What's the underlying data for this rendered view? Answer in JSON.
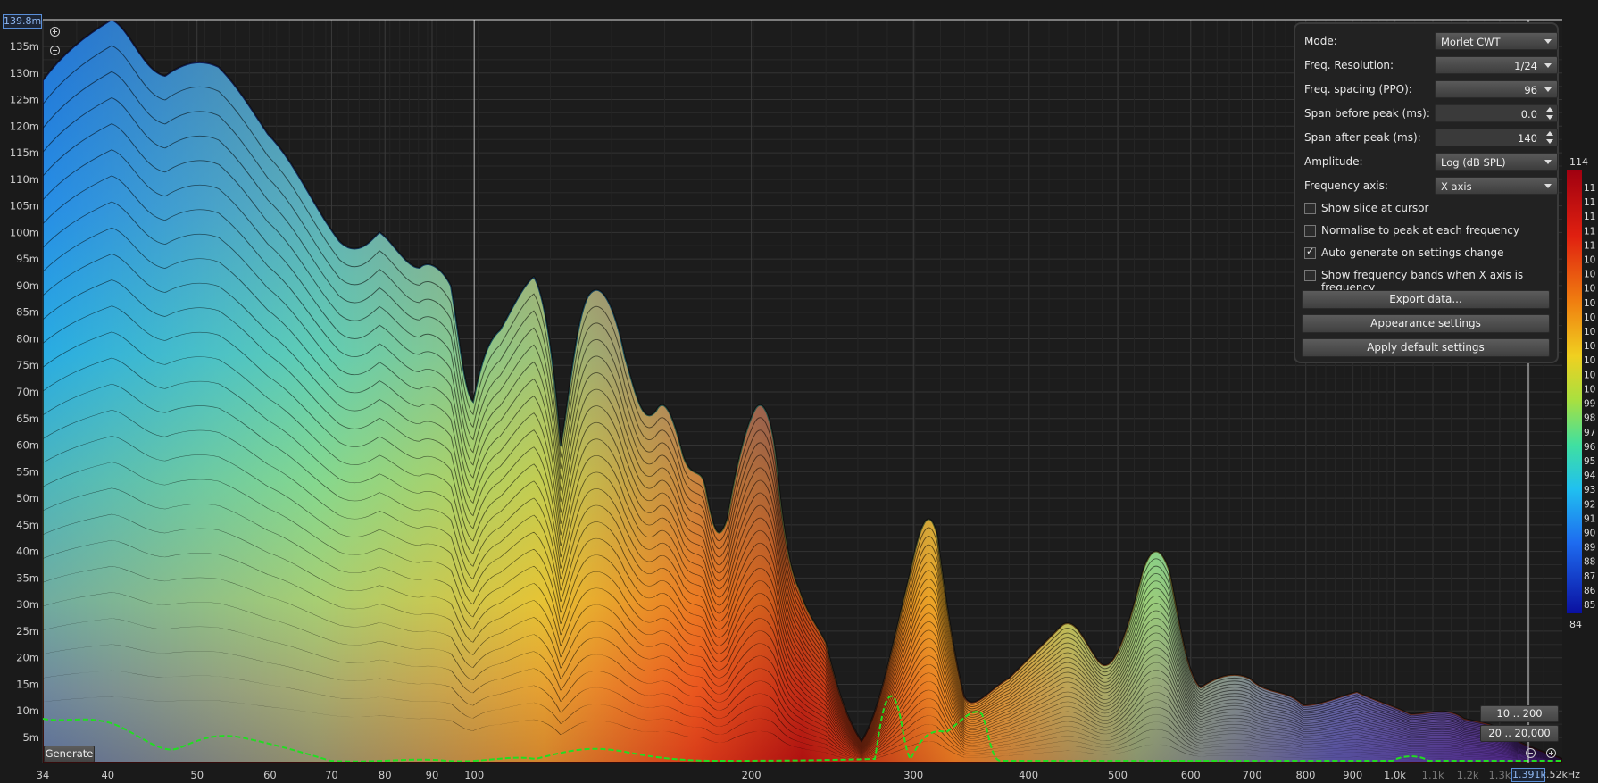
{
  "cursor": {
    "time_value": "139.8m",
    "freq_value": "1.391k"
  },
  "time_axis": {
    "labels": [
      "135m",
      "130m",
      "125m",
      "120m",
      "115m",
      "110m",
      "105m",
      "100m",
      "95m",
      "90m",
      "85m",
      "80m",
      "75m",
      "70m",
      "65m",
      "60m",
      "55m",
      "50m",
      "45m",
      "40m",
      "35m",
      "30m",
      "25m",
      "20m",
      "15m",
      "10m",
      "5m"
    ]
  },
  "freq_axis": {
    "labels": [
      "34",
      "40",
      "50",
      "60",
      "70",
      "80",
      "90",
      "100",
      "200",
      "300",
      "400",
      "500",
      "600",
      "700",
      "800",
      "900",
      "1.0k",
      "1.1k",
      "1.2k",
      "1.3k"
    ],
    "end_label": ".52kHz"
  },
  "settings": {
    "mode": {
      "label": "Mode:",
      "value": "Morlet CWT"
    },
    "freq_resolution": {
      "label": "Freq. Resolution:",
      "value": "1/24"
    },
    "freq_spacing": {
      "label": "Freq. spacing (PPO):",
      "value": "96"
    },
    "span_before": {
      "label": "Span before peak (ms):",
      "value": "0.0"
    },
    "span_after": {
      "label": "Span after peak (ms):",
      "value": "140"
    },
    "amplitude": {
      "label": "Amplitude:",
      "value": "Log (dB SPL)"
    },
    "frequency_axis": {
      "label": "Frequency axis:",
      "value": "X axis"
    },
    "checkboxes": [
      {
        "label": "Show slice at cursor",
        "checked": false
      },
      {
        "label": "Normalise to peak at each frequency",
        "checked": false
      },
      {
        "label": "Auto generate on settings change",
        "checked": true
      },
      {
        "label": "Show frequency bands when X axis is frequency",
        "checked": false
      }
    ],
    "export_button": "Export data...",
    "appearance_button": "Appearance settings",
    "defaults_button": "Apply default settings"
  },
  "color_scale": {
    "top_label": "114",
    "bottom_label": "84",
    "labels": [
      "11",
      "11",
      "11",
      "11",
      "11",
      "10",
      "10",
      "10",
      "10",
      "10",
      "10",
      "10",
      "10",
      "10",
      "10",
      "99",
      "98",
      "97",
      "96",
      "95",
      "94",
      "93",
      "92",
      "91",
      "90",
      "89",
      "88",
      "87",
      "86",
      "85"
    ]
  },
  "range_buttons": {
    "low": "10 .. 200",
    "full": "20 .. 20,000"
  },
  "generate_button": "Generate",
  "colors": {
    "background": "#1a1a1a",
    "grid": "#3a3a3a",
    "cursor_line": "#ffffff",
    "trace": "#22dd22"
  }
}
